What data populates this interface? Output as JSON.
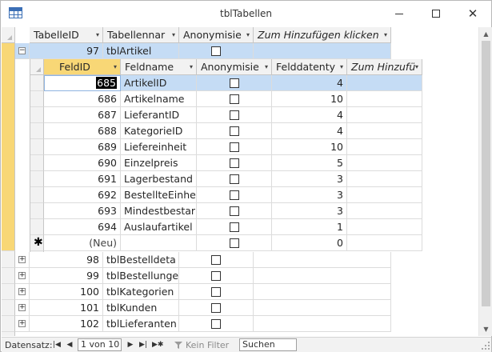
{
  "window": {
    "title": "tblTabellen"
  },
  "outer_table": {
    "columns": [
      "TabelleID",
      "Tabellennar",
      "Anonymisie",
      "Zum Hinzufügen klicken"
    ],
    "expanded_row": {
      "id": "97",
      "name": "tblArtikel",
      "anonymized": false
    },
    "collapsed_rows": [
      {
        "id": "98",
        "name": "tblBestelldeta"
      },
      {
        "id": "99",
        "name": "tblBestellunge"
      },
      {
        "id": "100",
        "name": "tblKategorien"
      },
      {
        "id": "101",
        "name": "tblKunden"
      },
      {
        "id": "102",
        "name": "tblLieferanten"
      }
    ]
  },
  "sub_table": {
    "columns": [
      "FeldID",
      "Feldname",
      "Anonymisie",
      "Felddatenty",
      "Zum Hinzufü"
    ],
    "rows": [
      {
        "id": "685",
        "name": "ArtikelID",
        "type": "4"
      },
      {
        "id": "686",
        "name": "Artikelname",
        "type": "10"
      },
      {
        "id": "687",
        "name": "LieferantID",
        "type": "4"
      },
      {
        "id": "688",
        "name": "KategorieID",
        "type": "4"
      },
      {
        "id": "689",
        "name": "Liefereinheit",
        "type": "10"
      },
      {
        "id": "690",
        "name": "Einzelpreis",
        "type": "5"
      },
      {
        "id": "691",
        "name": "Lagerbestand",
        "type": "3"
      },
      {
        "id": "692",
        "name": "BestellteEinhe",
        "type": "3"
      },
      {
        "id": "693",
        "name": "Mindestbestar",
        "type": "3"
      },
      {
        "id": "694",
        "name": "Auslaufartikel",
        "type": "1"
      }
    ],
    "new_row": {
      "id": "(Neu)",
      "type": "0",
      "marker": "✱"
    }
  },
  "navbar": {
    "label": "Datensatz:",
    "position": "1 von 10",
    "filter": "Kein Filter",
    "search": "Suchen"
  },
  "colors": {
    "selection": "#c5dcf5",
    "active_selector": "#f8d776",
    "header_bg": "#f2f2f2"
  }
}
